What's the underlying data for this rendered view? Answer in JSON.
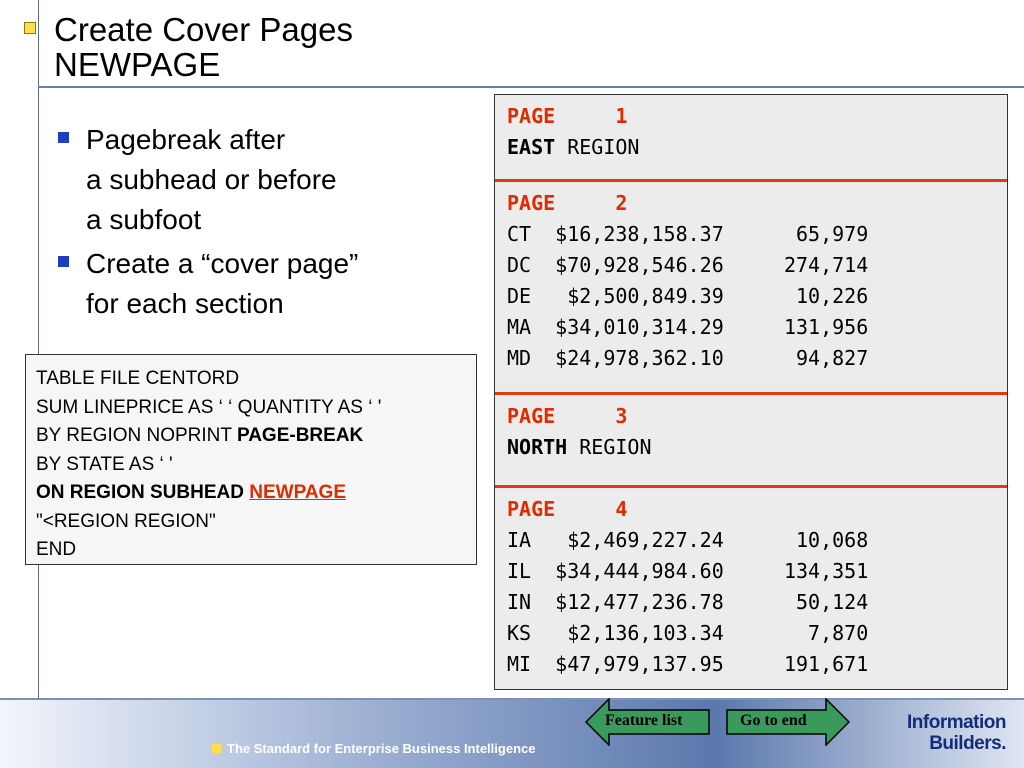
{
  "slide": {
    "title_line1": "Create Cover Pages",
    "title_line2": "NEWPAGE"
  },
  "bullets": [
    [
      "Pagebreak after",
      "a subhead or before",
      "a subfoot"
    ],
    [
      "Create a “cover page”",
      "for each section"
    ]
  ],
  "code": {
    "line1": "TABLE FILE CENTORD",
    "line2": "SUM LINEPRICE AS ‘ ‘ QUANTITY AS ‘ '",
    "line3_pre": "BY REGION NOPRINT ",
    "line3_bold": "PAGE-BREAK",
    "line4": "BY STATE AS ‘ '",
    "line5_bold": "ON REGION SUBHEAD ",
    "line5_red": "NEWPAGE",
    "line6": "\"<REGION REGION\"",
    "line7": "END"
  },
  "report": {
    "page_word": "PAGE",
    "region_word": "REGION",
    "sections": [
      {
        "page_number": "1",
        "region": "EAST",
        "rows": []
      },
      {
        "page_number": "2",
        "region": "",
        "rows": [
          {
            "state": "CT",
            "lineprice": "$16,238,158.37",
            "quantity": "65,979"
          },
          {
            "state": "DC",
            "lineprice": "$70,928,546.26",
            "quantity": "274,714"
          },
          {
            "state": "DE",
            "lineprice": "$2,500,849.39",
            "quantity": "10,226"
          },
          {
            "state": "MA",
            "lineprice": "$34,010,314.29",
            "quantity": "131,956"
          },
          {
            "state": "MD",
            "lineprice": "$24,978,362.10",
            "quantity": "94,827"
          }
        ]
      },
      {
        "page_number": "3",
        "region": "NORTH",
        "rows": []
      },
      {
        "page_number": "4",
        "region": "",
        "rows": [
          {
            "state": "IA",
            "lineprice": "$2,469,227.24",
            "quantity": "10,068"
          },
          {
            "state": "IL",
            "lineprice": "$34,444,984.60",
            "quantity": "134,351"
          },
          {
            "state": "IN",
            "lineprice": "$12,477,236.78",
            "quantity": "50,124"
          },
          {
            "state": "KS",
            "lineprice": "$2,136,103.34",
            "quantity": "7,870"
          },
          {
            "state": "MI",
            "lineprice": "$47,979,137.95",
            "quantity": "191,671"
          }
        ]
      }
    ]
  },
  "footer": {
    "tagline": "The Standard for Enterprise Business Intelligence",
    "prev_button": "Feature list",
    "next_button": "Go to end",
    "logo_line1": "Information",
    "logo_line2": "Builders.",
    "button_color": "#3a9a5c",
    "accent_red": "#e02b00"
  }
}
